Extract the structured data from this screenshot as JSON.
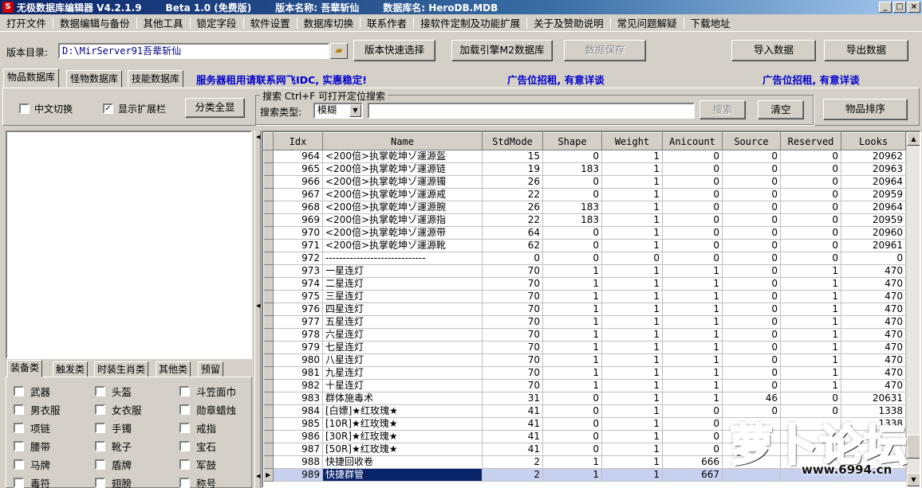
{
  "titlebar": {
    "app": "无极数据库编辑器 V4.2.1.9",
    "edition": "Beta 1.0 (免费版)",
    "version_name": "版本名称: 吾辈斩仙",
    "db_name": "数据库名: HeroDB.MDB",
    "minimize": "_",
    "maximize": "□",
    "close": "×"
  },
  "menu": [
    "打开文件",
    "数据编辑与备份",
    "其他工具",
    "锁定字段",
    "软件设置",
    "数据库切换",
    "联系作者",
    "接软件定制及功能扩展",
    "关于及赞助说明",
    "常见问题解疑",
    "下载地址"
  ],
  "version_row": {
    "label": "版本目录:",
    "path": "D:\\MirServer91吾辈斩仙",
    "quick_select": "版本快速选择",
    "load_engine": "加载引擎M2数据库",
    "save_data": "数据保存",
    "import": "导入数据",
    "export": "导出数据"
  },
  "tabs": [
    "物品数据库",
    "怪物数据库",
    "技能数据库"
  ],
  "notices": [
    "服务器租用请联系网飞IDC, 实惠稳定!",
    "广告位招租, 有意详谈",
    "广告位招租, 有意详谈"
  ],
  "toolbar": {
    "chinese_switch": "中文切换",
    "show_ext": "显示扩展栏",
    "show_all": "分类全显",
    "check_mark": "✓",
    "search_group": "搜索  Ctrl+F 可打开定位搜索",
    "search_type_label": "搜索类型:",
    "search_type_value": "模糊",
    "search_btn": "搜索",
    "clear_btn": "清空",
    "sort_btn": "物品排序"
  },
  "category_tabs": [
    "装备类",
    "触发类",
    "时装生肖类",
    "其他类",
    "预留"
  ],
  "categories": [
    "武器",
    "头盔",
    "斗笠面巾",
    "男衣服",
    "女衣服",
    "勋章蜡烛",
    "项链",
    "手镯",
    "戒指",
    "腰带",
    "靴子",
    "宝石",
    "马牌",
    "盾牌",
    "军鼓",
    "毒符",
    "翅膀",
    "称号"
  ],
  "grid": {
    "columns": [
      "Idx",
      "Name",
      "StdMode",
      "Shape",
      "Weight",
      "Anicount",
      "Source",
      "Reserved",
      "Looks"
    ],
    "rows": [
      [
        "964",
        "<200倍>执掌乾坤ゾ運源盔",
        "15",
        "0",
        "1",
        "0",
        "0",
        "0",
        "20962"
      ],
      [
        "965",
        "<200倍>执掌乾坤ゾ運源链",
        "19",
        "183",
        "1",
        "0",
        "0",
        "0",
        "20963"
      ],
      [
        "966",
        "<200倍>执掌乾坤ゾ運源镯",
        "26",
        "0",
        "1",
        "0",
        "0",
        "0",
        "20964"
      ],
      [
        "967",
        "<200倍>执掌乾坤ゾ運源戒",
        "22",
        "0",
        "1",
        "0",
        "0",
        "0",
        "20959"
      ],
      [
        "968",
        "<200倍>执掌乾坤ゾ運源腕",
        "26",
        "183",
        "1",
        "0",
        "0",
        "0",
        "20964"
      ],
      [
        "969",
        "<200倍>执掌乾坤ゾ運源指",
        "22",
        "183",
        "1",
        "0",
        "0",
        "0",
        "20959"
      ],
      [
        "970",
        "<200倍>执掌乾坤ゾ運源带",
        "64",
        "0",
        "1",
        "0",
        "0",
        "0",
        "20960"
      ],
      [
        "971",
        "<200倍>执掌乾坤ゾ運源靴",
        "62",
        "0",
        "1",
        "0",
        "0",
        "0",
        "20961"
      ],
      [
        "972",
        "-----------------------------",
        "0",
        "0",
        "0",
        "0",
        "0",
        "0",
        "0"
      ],
      [
        "973",
        "一星连灯",
        "70",
        "1",
        "1",
        "1",
        "0",
        "1",
        "470"
      ],
      [
        "974",
        "二星连灯",
        "70",
        "1",
        "1",
        "1",
        "0",
        "1",
        "470"
      ],
      [
        "975",
        "三星连灯",
        "70",
        "1",
        "1",
        "1",
        "0",
        "1",
        "470"
      ],
      [
        "976",
        "四星连灯",
        "70",
        "1",
        "1",
        "1",
        "0",
        "1",
        "470"
      ],
      [
        "977",
        "五星连灯",
        "70",
        "1",
        "1",
        "1",
        "0",
        "1",
        "470"
      ],
      [
        "978",
        "六星连灯",
        "70",
        "1",
        "1",
        "1",
        "0",
        "1",
        "470"
      ],
      [
        "979",
        "七星连灯",
        "70",
        "1",
        "1",
        "1",
        "0",
        "1",
        "470"
      ],
      [
        "980",
        "八星连灯",
        "70",
        "1",
        "1",
        "1",
        "0",
        "1",
        "470"
      ],
      [
        "981",
        "九星连灯",
        "70",
        "1",
        "1",
        "1",
        "0",
        "1",
        "470"
      ],
      [
        "982",
        "十星连灯",
        "70",
        "1",
        "1",
        "1",
        "0",
        "1",
        "470"
      ],
      [
        "983",
        "群体施毒术",
        "31",
        "0",
        "1",
        "1",
        "46",
        "0",
        "20631"
      ],
      [
        "984",
        "[白嫖]★红玫瑰★",
        "41",
        "0",
        "1",
        "0",
        "0",
        "0",
        "1338"
      ],
      [
        "985",
        "[10R]★红玫瑰★",
        "41",
        "0",
        "1",
        "0",
        "",
        "",
        "1338"
      ],
      [
        "986",
        "[30R]★红玫瑰★",
        "41",
        "0",
        "1",
        "0",
        "",
        "",
        ""
      ],
      [
        "987",
        "[50R]★红玫瑰★",
        "41",
        "0",
        "1",
        "0",
        "",
        "",
        ""
      ],
      [
        "988",
        "快捷回收卷",
        "2",
        "1",
        "1",
        "666",
        "",
        "",
        ""
      ],
      [
        "989",
        "快捷群管",
        "2",
        "1",
        "1",
        "667",
        "",
        "",
        ""
      ]
    ],
    "selected_index": 25
  },
  "watermark": {
    "text": "萝卜论坛",
    "url": "www.6994.cn"
  }
}
